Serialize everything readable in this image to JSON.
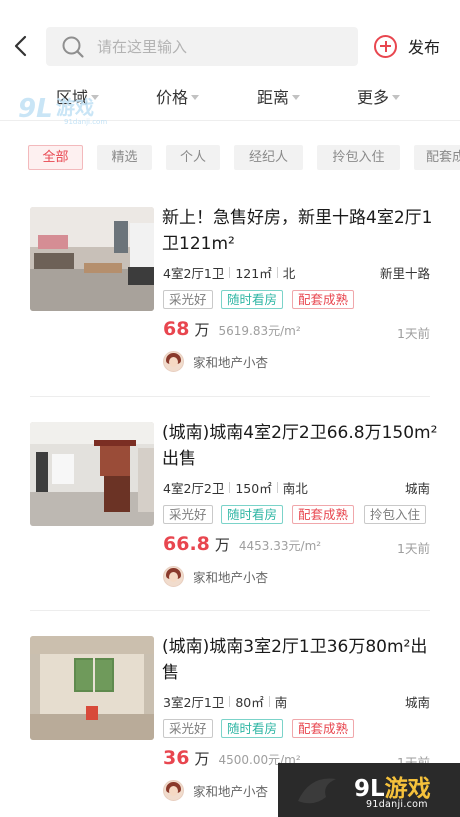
{
  "header": {
    "search_placeholder": "请在这里输入",
    "publish_label": "发布"
  },
  "filters": [
    {
      "label": "区域"
    },
    {
      "label": "价格"
    },
    {
      "label": "距离"
    },
    {
      "label": "更多"
    }
  ],
  "tags": [
    {
      "label": "全部",
      "active": true
    },
    {
      "label": "精选",
      "active": false
    },
    {
      "label": "个人",
      "active": false
    },
    {
      "label": "经纪人",
      "active": false
    },
    {
      "label": "拎包入住",
      "active": false
    },
    {
      "label": "配套成熟",
      "active": false
    }
  ],
  "listings": [
    {
      "title": "新上！急售好房，新里十路4室2厅1卫121m²",
      "layout": "4室2厅1卫",
      "area": "121㎡",
      "orientation": "北",
      "district": "新里十路",
      "features": [
        "采光好",
        "随时看房",
        "配套成熟"
      ],
      "price": "68",
      "price_unit": "万",
      "price_per_m2": "5619.83元/m²",
      "time": "1天前",
      "agent": "家和地产小杏"
    },
    {
      "title": "(城南)城南4室2厅2卫66.8万150m²出售",
      "layout": "4室2厅2卫",
      "area": "150㎡",
      "orientation": "南北",
      "district": "城南",
      "features": [
        "采光好",
        "随时看房",
        "配套成熟",
        "拎包入住"
      ],
      "price": "66.8",
      "price_unit": "万",
      "price_per_m2": "4453.33元/m²",
      "time": "1天前",
      "agent": "家和地产小杏"
    },
    {
      "title": "(城南)城南3室2厅1卫36万80m²出售",
      "layout": "3室2厅1卫",
      "area": "80㎡",
      "orientation": "南",
      "district": "城南",
      "features": [
        "采光好",
        "随时看房",
        "配套成熟"
      ],
      "price": "36",
      "price_unit": "万",
      "price_per_m2": "4500.00元/m²",
      "time": "1天前",
      "agent": "家和地产小杏"
    }
  ],
  "watermark": {
    "logo_digits": "9L",
    "logo_text": "游戏",
    "site": "91danji.com"
  },
  "colors": {
    "accent": "#e8464f",
    "teal": "#2fb6a4",
    "muted": "#9e9e9e"
  }
}
